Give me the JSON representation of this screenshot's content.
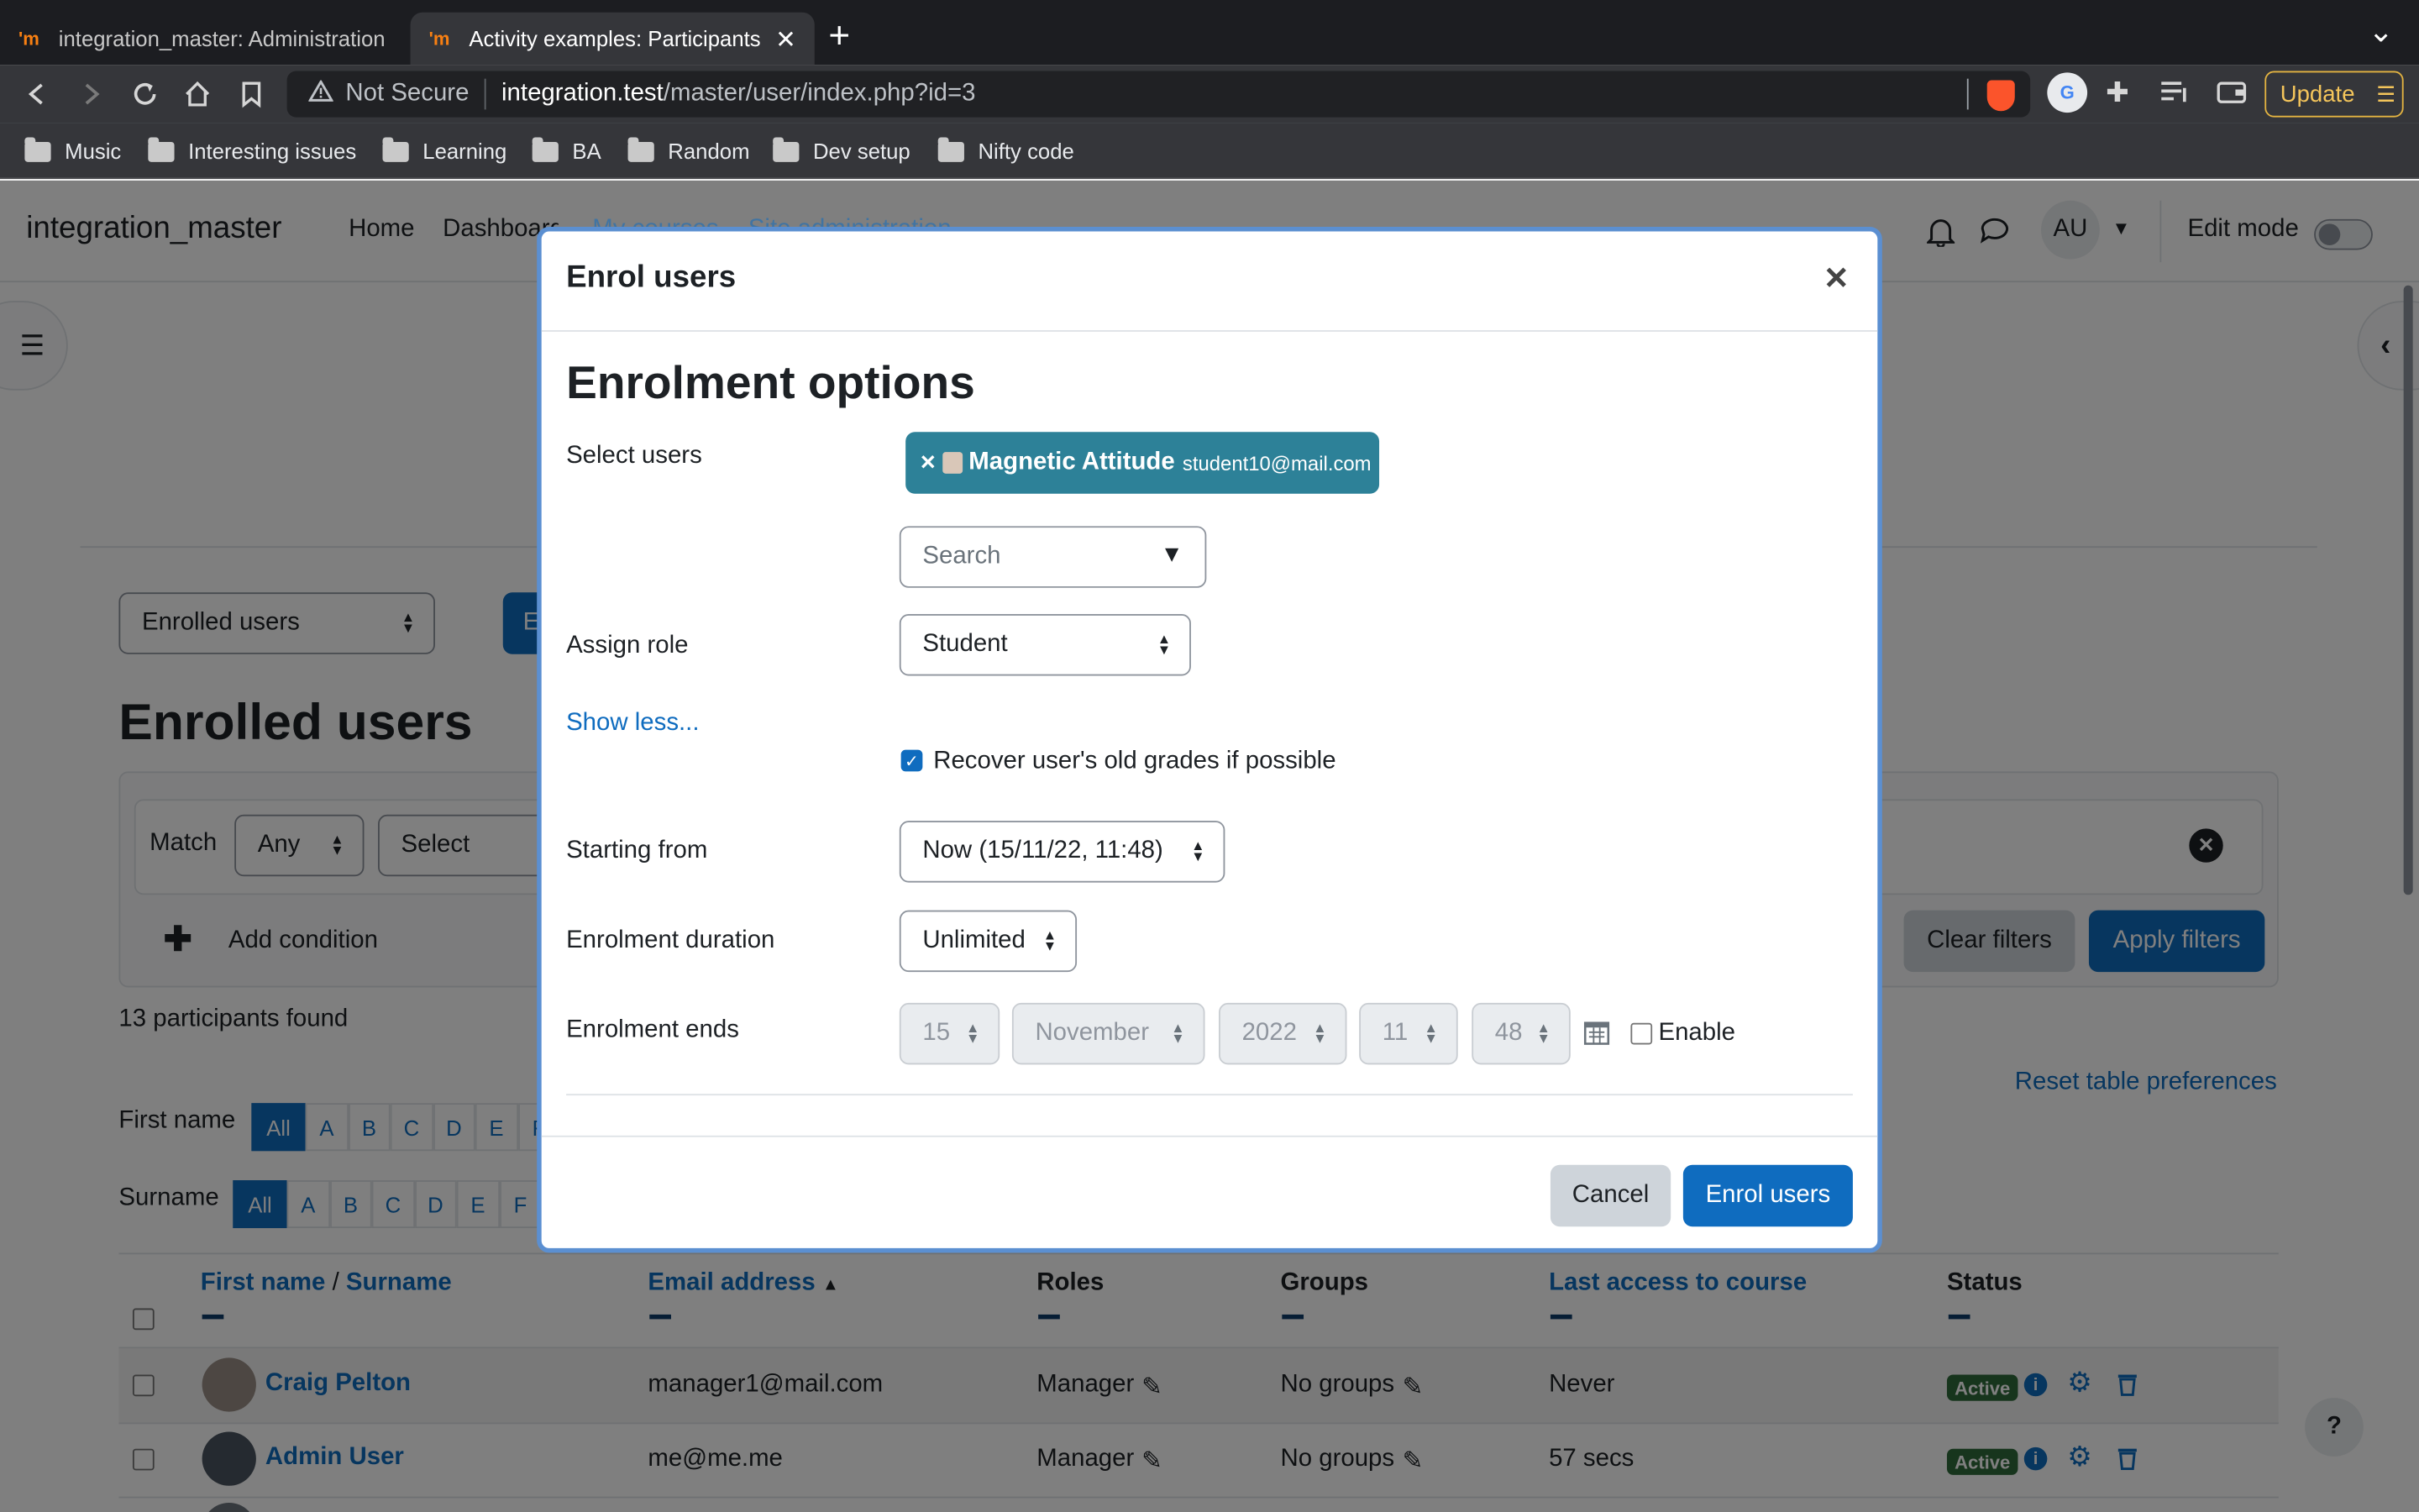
{
  "browser": {
    "tabs": [
      {
        "title": "integration_master: Administration"
      },
      {
        "title": "Activity examples: Participants"
      }
    ],
    "new_tab": "+",
    "tab_menu": "⌄",
    "security": "Not Secure",
    "url_host": "integration.test",
    "url_path": "/master/user/index.php?id=3",
    "update_label": "Update",
    "bookmarks": [
      "Music",
      "Interesting issues",
      "Learning",
      "BA",
      "Random",
      "Dev setup",
      "Nifty code"
    ]
  },
  "site": {
    "name": "integration_master",
    "nav": [
      "Home",
      "Dashboard",
      "My courses",
      "Site administration"
    ],
    "avatar": "AU",
    "edit_mode": "Edit mode"
  },
  "page": {
    "enrolment_select": "Enrolled users",
    "enrol_btn": "E",
    "heading": "Enrolled users",
    "match_label": "Match",
    "match_value": "Any",
    "select_placeholder": "Select",
    "add_condition": "Add condition",
    "clear_filters": "Clear filters",
    "apply_filters": "Apply filters",
    "found": "13 participants found",
    "reset_prefs": "Reset table preferences",
    "first_name_label": "First name",
    "surname_label": "Surname",
    "first_letters": [
      "All",
      "A",
      "B",
      "C",
      "D",
      "E",
      "F"
    ],
    "surname_letters": [
      "All",
      "A",
      "B",
      "C",
      "D",
      "E",
      "F"
    ]
  },
  "table": {
    "col_first": "First name",
    "col_sep": " / ",
    "col_surname": "Surname",
    "col_email": "Email address",
    "col_roles": "Roles",
    "col_groups": "Groups",
    "col_access": "Last access to course",
    "col_status": "Status",
    "rows": [
      {
        "name": "Craig Pelton",
        "email": "manager1@mail.com",
        "role": "Manager",
        "groups": "No groups",
        "access": "Never",
        "status": "Active"
      },
      {
        "name": "Admin User",
        "email": "me@me.me",
        "role": "Manager",
        "groups": "No groups",
        "access": "57 secs",
        "status": "Active"
      }
    ]
  },
  "modal": {
    "title": "Enrol users",
    "section": "Enrolment options",
    "select_users_label": "Select users",
    "selected_user_name": "Magnetic Attitude",
    "selected_user_email": "student10@mail.com",
    "search_placeholder": "Search",
    "assign_role_label": "Assign role",
    "role_value": "Student",
    "show_less": "Show less...",
    "recover_label": "Recover user's old grades if possible",
    "recover_checked": true,
    "starting_label": "Starting from",
    "starting_value": "Now (15/11/22, 11:48)",
    "duration_label": "Enrolment duration",
    "duration_value": "Unlimited",
    "ends_label": "Enrolment ends",
    "ends_day": "15",
    "ends_month": "November",
    "ends_year": "2022",
    "ends_hour": "11",
    "ends_minute": "48",
    "enable_label": "Enable",
    "cancel": "Cancel",
    "submit": "Enrol users"
  },
  "colors": {
    "primary": "#0f6cbf",
    "badge": "#2f6a3a",
    "modal_chip": "#2d8198"
  }
}
